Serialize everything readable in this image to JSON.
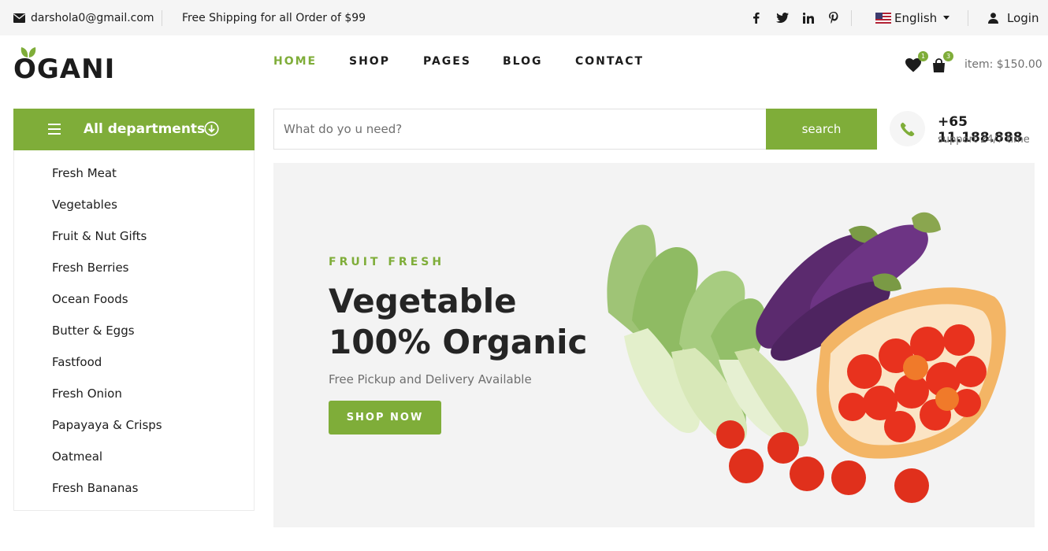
{
  "topbar": {
    "email": "darshola0@gmail.com",
    "shipping": "Free Shipping for all Order of $99",
    "language": "English",
    "login": "Login"
  },
  "logo": {
    "text": "OGANI"
  },
  "nav": {
    "items": [
      {
        "label": "HOME",
        "active": true
      },
      {
        "label": "SHOP",
        "active": false
      },
      {
        "label": "PAGES",
        "active": false
      },
      {
        "label": "BLOG",
        "active": false
      },
      {
        "label": "CONTACT",
        "active": false
      }
    ]
  },
  "header": {
    "wishlist_count": "1",
    "cart_count": "3",
    "cart_total": "item: $150.00"
  },
  "departments": {
    "title": "All departments",
    "items": [
      "Fresh Meat",
      "Vegetables",
      "Fruit & Nut Gifts",
      "Fresh Berries",
      "Ocean Foods",
      "Butter & Eggs",
      "Fastfood",
      "Fresh Onion",
      "Papayaya & Crisps",
      "Oatmeal",
      "Fresh Bananas"
    ]
  },
  "search": {
    "placeholder": "What do yo u need?",
    "button": "search"
  },
  "contact": {
    "phone": "+65 11.188.888",
    "support": "support 24/7 time"
  },
  "hero": {
    "kicker": "FRUIT FRESH",
    "title_line1": "Vegetable",
    "title_line2": "100% Organic",
    "subtitle": "Free Pickup and Delivery Available",
    "button": "SHOP NOW"
  },
  "colors": {
    "accent": "#7fad39",
    "topbar_bg": "#f5f5f5",
    "hero_bg": "#f3f3f3"
  }
}
